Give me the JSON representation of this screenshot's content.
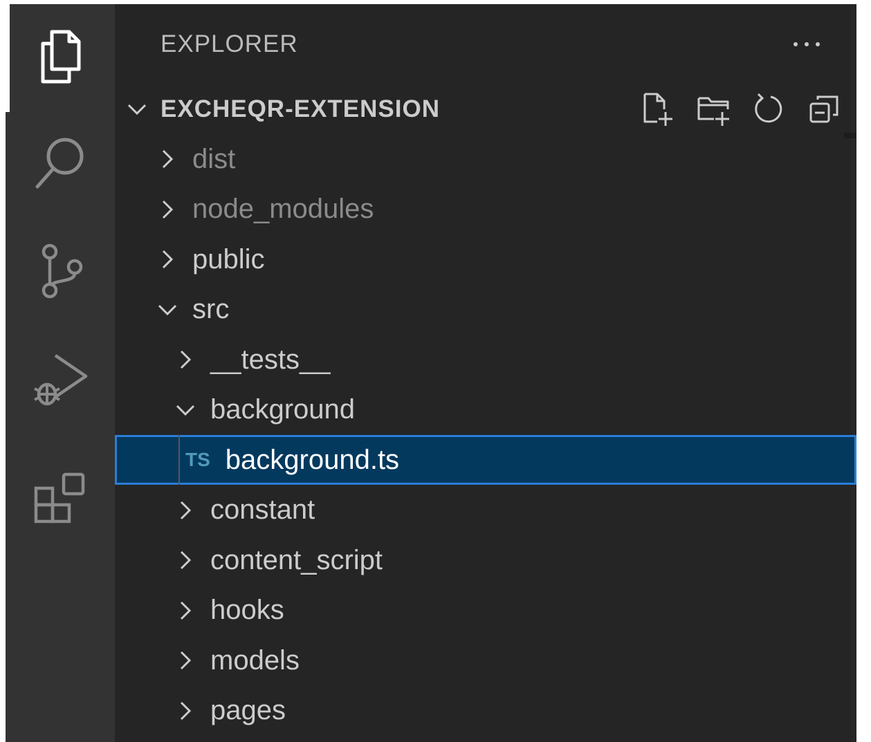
{
  "sidebar": {
    "title": "EXPLORER",
    "more_actions_icon": "ellipsis-icon"
  },
  "workspace": {
    "name": "EXCHEQR-EXTENSION",
    "expanded": true,
    "actions": [
      {
        "name": "new-file-button",
        "icon": "new-file-icon"
      },
      {
        "name": "new-folder-button",
        "icon": "new-folder-icon"
      },
      {
        "name": "refresh-button",
        "icon": "refresh-icon"
      },
      {
        "name": "collapse-all-button",
        "icon": "collapse-all-icon"
      }
    ]
  },
  "activity_bar": [
    {
      "icon": "files-icon",
      "active": true
    },
    {
      "icon": "search-icon",
      "active": false
    },
    {
      "icon": "source-control-icon",
      "active": false
    },
    {
      "icon": "run-debug-icon",
      "active": false
    },
    {
      "icon": "extensions-icon",
      "active": false
    }
  ],
  "tree": [
    {
      "label": "dist",
      "type": "folder",
      "depth": 1,
      "expanded": false,
      "dimmed": true
    },
    {
      "label": "node_modules",
      "type": "folder",
      "depth": 1,
      "expanded": false,
      "dimmed": true
    },
    {
      "label": "public",
      "type": "folder",
      "depth": 1,
      "expanded": false,
      "dimmed": false
    },
    {
      "label": "src",
      "type": "folder",
      "depth": 1,
      "expanded": true,
      "dimmed": false
    },
    {
      "label": "__tests__",
      "type": "folder",
      "depth": 2,
      "expanded": false,
      "dimmed": false
    },
    {
      "label": "background",
      "type": "folder",
      "depth": 2,
      "expanded": true,
      "dimmed": false
    },
    {
      "label": "background.ts",
      "type": "file",
      "badge": "TS",
      "depth": 3,
      "selected": true
    },
    {
      "label": "constant",
      "type": "folder",
      "depth": 2,
      "expanded": false,
      "dimmed": false
    },
    {
      "label": "content_script",
      "type": "folder",
      "depth": 2,
      "expanded": false,
      "dimmed": false
    },
    {
      "label": "hooks",
      "type": "folder",
      "depth": 2,
      "expanded": false,
      "dimmed": false
    },
    {
      "label": "models",
      "type": "folder",
      "depth": 2,
      "expanded": false,
      "dimmed": false
    },
    {
      "label": "pages",
      "type": "folder",
      "depth": 2,
      "expanded": false,
      "dimmed": false
    }
  ],
  "colors": {
    "activity_bar": "#333333",
    "sidebar": "#252526",
    "selection": "#04395e",
    "focus_border": "#2a7ed6",
    "ts_badge": "#519aba"
  }
}
